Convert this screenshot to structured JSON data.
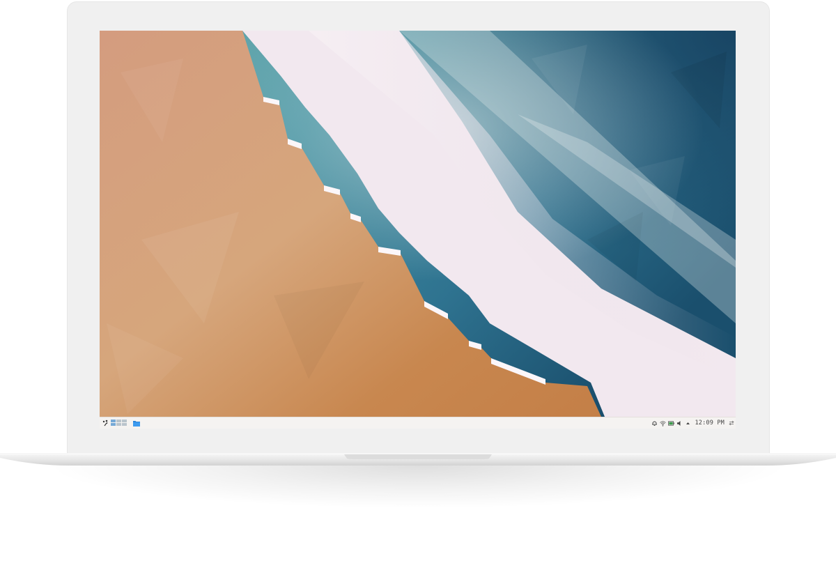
{
  "device": "laptop",
  "wallpaper": {
    "description_colors": {
      "sand": "#cf9468",
      "sand_light": "#dcae82",
      "foam": "#f3eaf0",
      "sea_light": "#5f9fa9",
      "sea_dark": "#1d5573"
    }
  },
  "taskbar": {
    "launcher_icon": "plasma-launcher-icon",
    "pager_icon": "virtual-desktop-pager",
    "tasks": [
      {
        "icon": "folder-icon",
        "app": "Files"
      }
    ],
    "tray": {
      "icons": [
        "notifications-icon",
        "wifi-icon",
        "battery-icon",
        "volume-icon",
        "expand-tray-icon"
      ],
      "clock": "12:09 PM"
    }
  },
  "colors": {
    "taskbar_bg": "#f5f3f1",
    "accent": "#3d8ee0",
    "lid": "#f0f0f0"
  }
}
